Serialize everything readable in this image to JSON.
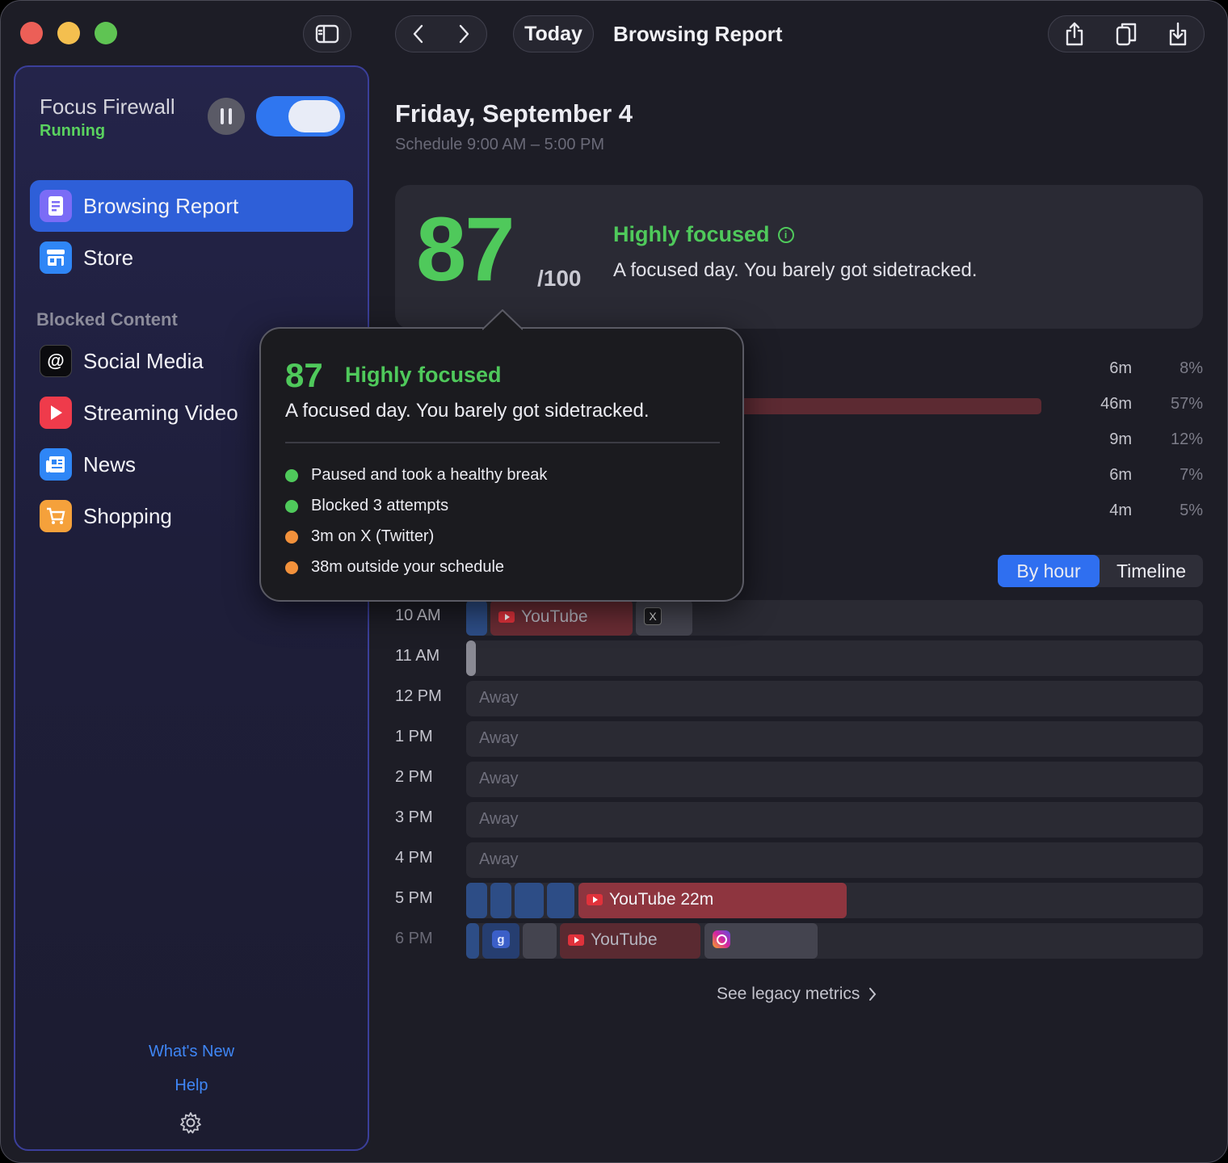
{
  "window": {
    "title": "Browsing Report"
  },
  "toolbar": {
    "today_label": "Today",
    "title": "Browsing Report"
  },
  "sidebar": {
    "app_name": "Focus Firewall",
    "status": "Running",
    "toggle_on": true,
    "nav": [
      {
        "label": "Browsing Report",
        "icon": "report-icon",
        "active": true,
        "color": "#7b6cf6"
      },
      {
        "label": "Store",
        "icon": "store-icon",
        "active": false,
        "color": "#2f86f6"
      }
    ],
    "section_label": "Blocked Content",
    "blocked": [
      {
        "label": "Social Media",
        "icon": "at-icon",
        "color": "#0b0b0e"
      },
      {
        "label": "Streaming Video",
        "icon": "play-icon",
        "color": "#ef3b4b"
      },
      {
        "label": "News",
        "icon": "news-icon",
        "color": "#2f86f6"
      },
      {
        "label": "Shopping",
        "icon": "cart-icon",
        "color": "#f5a13b"
      }
    ],
    "footer": {
      "whats_new": "What's New",
      "help": "Help"
    }
  },
  "report": {
    "date": "Friday, September 4",
    "schedule": "Schedule 9:00 AM – 5:00 PM",
    "score": "87",
    "score_max": "/100",
    "score_heading": "Highly focused",
    "score_desc": "A focused day. You barely got sidetracked.",
    "stats": [
      {
        "duration": "6m",
        "percent": "8%",
        "fraction": 0
      },
      {
        "duration": "46m",
        "percent": "57%",
        "fraction": 0.57
      },
      {
        "duration": "9m",
        "percent": "12%",
        "fraction": 0
      },
      {
        "duration": "6m",
        "percent": "7%",
        "fraction": 0
      },
      {
        "duration": "4m",
        "percent": "5%",
        "fraction": 0
      }
    ],
    "view_toggle": {
      "by_hour": "By hour",
      "timeline": "Timeline",
      "selected": "By hour"
    },
    "hours": [
      {
        "label": "10 AM",
        "kind": "blocks"
      },
      {
        "label": "11 AM",
        "kind": "blocks"
      },
      {
        "label": "12 PM",
        "kind": "away",
        "text": "Away"
      },
      {
        "label": "1 PM",
        "kind": "away",
        "text": "Away"
      },
      {
        "label": "2 PM",
        "kind": "away",
        "text": "Away"
      },
      {
        "label": "3 PM",
        "kind": "away",
        "text": "Away"
      },
      {
        "label": "4 PM",
        "kind": "away",
        "text": "Away"
      },
      {
        "label": "5 PM",
        "kind": "blocks"
      },
      {
        "label": "6 PM",
        "kind": "blocks"
      }
    ],
    "blocks": {
      "h10_youtube": "YouTube",
      "h17_youtube": "YouTube 22m",
      "h18_youtube": "YouTube"
    },
    "legacy_link": "See legacy metrics"
  },
  "popover": {
    "score": "87",
    "heading": "Highly focused",
    "desc": "A focused day. You barely got sidetracked.",
    "items": [
      {
        "text": "Paused and took a healthy break",
        "color": "#4fc95b"
      },
      {
        "text": "Blocked 3 attempts",
        "color": "#4fc95b"
      },
      {
        "text": "3m on X (Twitter)",
        "color": "#f2913b"
      },
      {
        "text": "38m outside your schedule",
        "color": "#f2913b"
      }
    ]
  },
  "colors": {
    "accent": "#2f6ff0",
    "focus_green": "#4fc95b",
    "warn_orange": "#f2913b"
  }
}
